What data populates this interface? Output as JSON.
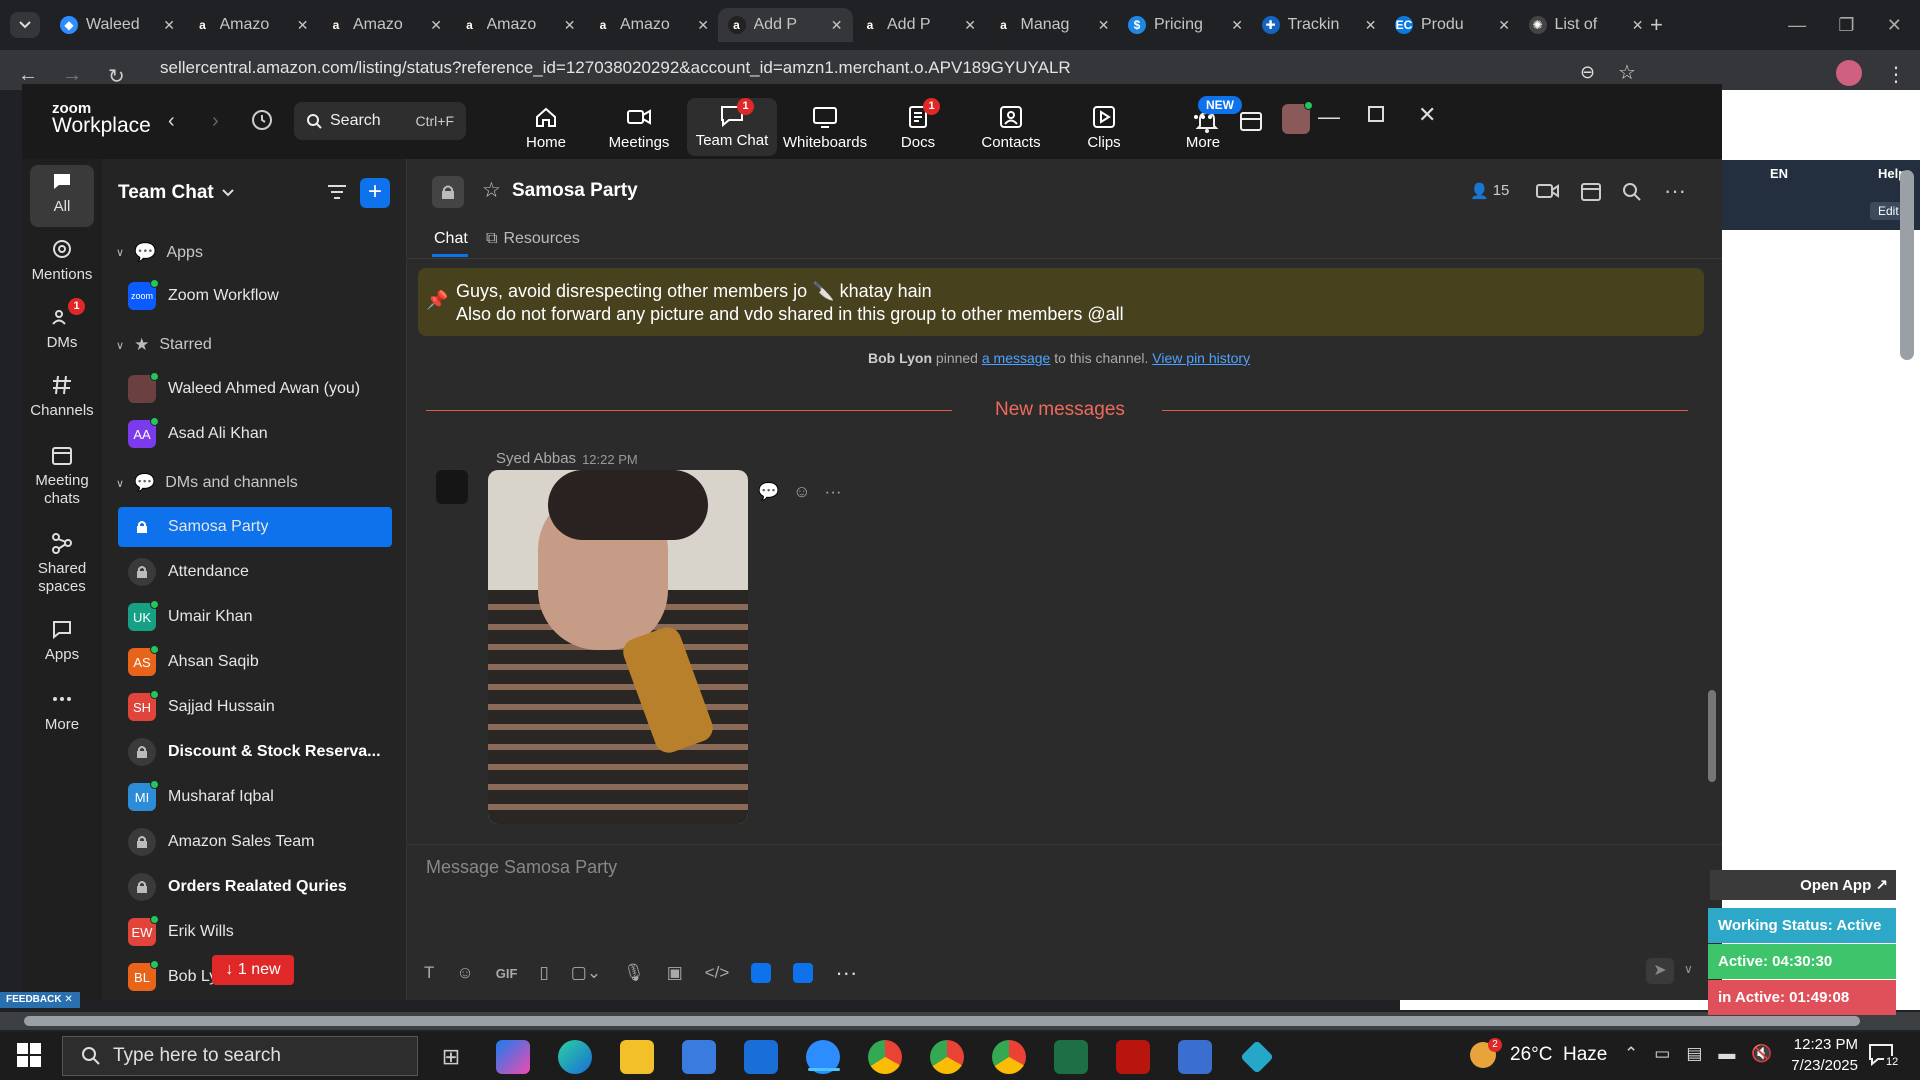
{
  "browser": {
    "tabs": [
      {
        "label": "Waleed",
        "icon": "zoom-favicon"
      },
      {
        "label": "Amazo",
        "icon": "amazon-favicon"
      },
      {
        "label": "Amazo",
        "icon": "amazon-favicon"
      },
      {
        "label": "Amazo",
        "icon": "amazon-favicon"
      },
      {
        "label": "Amazo",
        "icon": "amazon-favicon"
      },
      {
        "label": "Add P",
        "icon": "amazon-favicon"
      },
      {
        "label": "Add P",
        "icon": "amazon-favicon"
      },
      {
        "label": "Manag",
        "icon": "amazon-favicon"
      },
      {
        "label": "Pricing",
        "icon": "s-favicon"
      },
      {
        "label": "Trackin",
        "icon": "tracking-favicon"
      },
      {
        "label": "Produ",
        "icon": "ec-favicon"
      },
      {
        "label": "List of",
        "icon": "openai-favicon"
      }
    ],
    "url": "sellercentral.amazon.com/listing/status?reference_id=127038020292&account_id=amzn1.merchant.o.APV189GYUYALR",
    "page_help": "Help",
    "page_lang": "EN",
    "page_edit": "Edit"
  },
  "zoom": {
    "logo_top": "zoom",
    "logo_bottom": "Workplace",
    "search_label": "Search",
    "search_shortcut": "Ctrl+F",
    "nav": [
      {
        "label": "Home",
        "icon": "home-icon"
      },
      {
        "label": "Meetings",
        "icon": "video-camera-icon"
      },
      {
        "label": "Team Chat",
        "icon": "chat-bubble-icon",
        "badge": "1"
      },
      {
        "label": "Whiteboards",
        "icon": "whiteboard-icon"
      },
      {
        "label": "Docs",
        "icon": "docs-icon",
        "badge": "1"
      },
      {
        "label": "Contacts",
        "icon": "contacts-icon"
      },
      {
        "label": "Clips",
        "icon": "clips-icon"
      },
      {
        "label": "More",
        "icon": "more-icon",
        "tag": "NEW"
      }
    ],
    "left_nav": [
      {
        "label": "All"
      },
      {
        "label": "Mentions"
      },
      {
        "label": "DMs",
        "badge": "1"
      },
      {
        "label": "Channels"
      },
      {
        "label": "Meeting chats"
      },
      {
        "label": "Shared spaces"
      },
      {
        "label": "Apps"
      },
      {
        "label": "More"
      }
    ],
    "sidebar": {
      "title": "Team Chat",
      "sections": {
        "apps": "Apps",
        "starred": "Starred",
        "dms": "DMs and channels"
      },
      "apps_items": [
        {
          "label": "Zoom Workflow",
          "avatar": "zoom"
        }
      ],
      "starred_items": [
        {
          "label": "Waleed Ahmed Awan (you)",
          "avatar": ""
        },
        {
          "label": "Asad Ali Khan",
          "avatar": "AA"
        }
      ],
      "channel_items": [
        {
          "label": "Samosa Party",
          "avatar": "",
          "bold": false
        },
        {
          "label": "Attendance",
          "avatar": "",
          "bold": false
        },
        {
          "label": "Umair Khan",
          "avatar": "UK",
          "bold": false
        },
        {
          "label": "Ahsan Saqib",
          "avatar": "AS",
          "bold": false
        },
        {
          "label": "Sajjad Hussain",
          "avatar": "SH",
          "bold": false
        },
        {
          "label": "Discount & Stock Reserva...",
          "avatar": "",
          "bold": true
        },
        {
          "label": "Musharaf Iqbal",
          "avatar": "MI",
          "bold": false
        },
        {
          "label": "Amazon Sales Team",
          "avatar": "",
          "bold": false
        },
        {
          "label": "Orders Realated Quries",
          "avatar": "",
          "bold": true
        },
        {
          "label": "Erik Wills",
          "avatar": "EW",
          "bold": false
        },
        {
          "label": "Bob Ly",
          "avatar": "BL",
          "bold": false
        }
      ],
      "new_pill": "1 new"
    },
    "channel": {
      "name": "Samosa Party",
      "members": "15",
      "tabs": [
        "Chat",
        "Resources"
      ],
      "pinned_line1": "Guys, avoid disrespecting other members jo 🔪 khatay hain",
      "pinned_line2": "Also do not forward any picture and vdo shared in this group to other members @all",
      "pin_actor": "Bob Lyon",
      "pin_text1": "pinned",
      "pin_link": "a message",
      "pin_text2": "to this channel.",
      "pin_history": "View pin history",
      "new_messages": "New messages",
      "message_sender": "Syed Abbas",
      "message_time": "12:22 PM",
      "composer_placeholder": "Message Samosa Party",
      "composer_gif": "GIF"
    }
  },
  "extension": {
    "open_app": "Open App ↗",
    "working_status": "Working Status: Active",
    "active": "Active: 04:30:30",
    "inactive": "in Active: 01:49:08"
  },
  "feedback": "FEEDBACK",
  "taskbar": {
    "search_placeholder": "Type here to search",
    "weather": "26°C  Haze",
    "weather_badge": "2",
    "time": "12:23 PM",
    "date": "7/23/2025",
    "notifications": "12"
  }
}
